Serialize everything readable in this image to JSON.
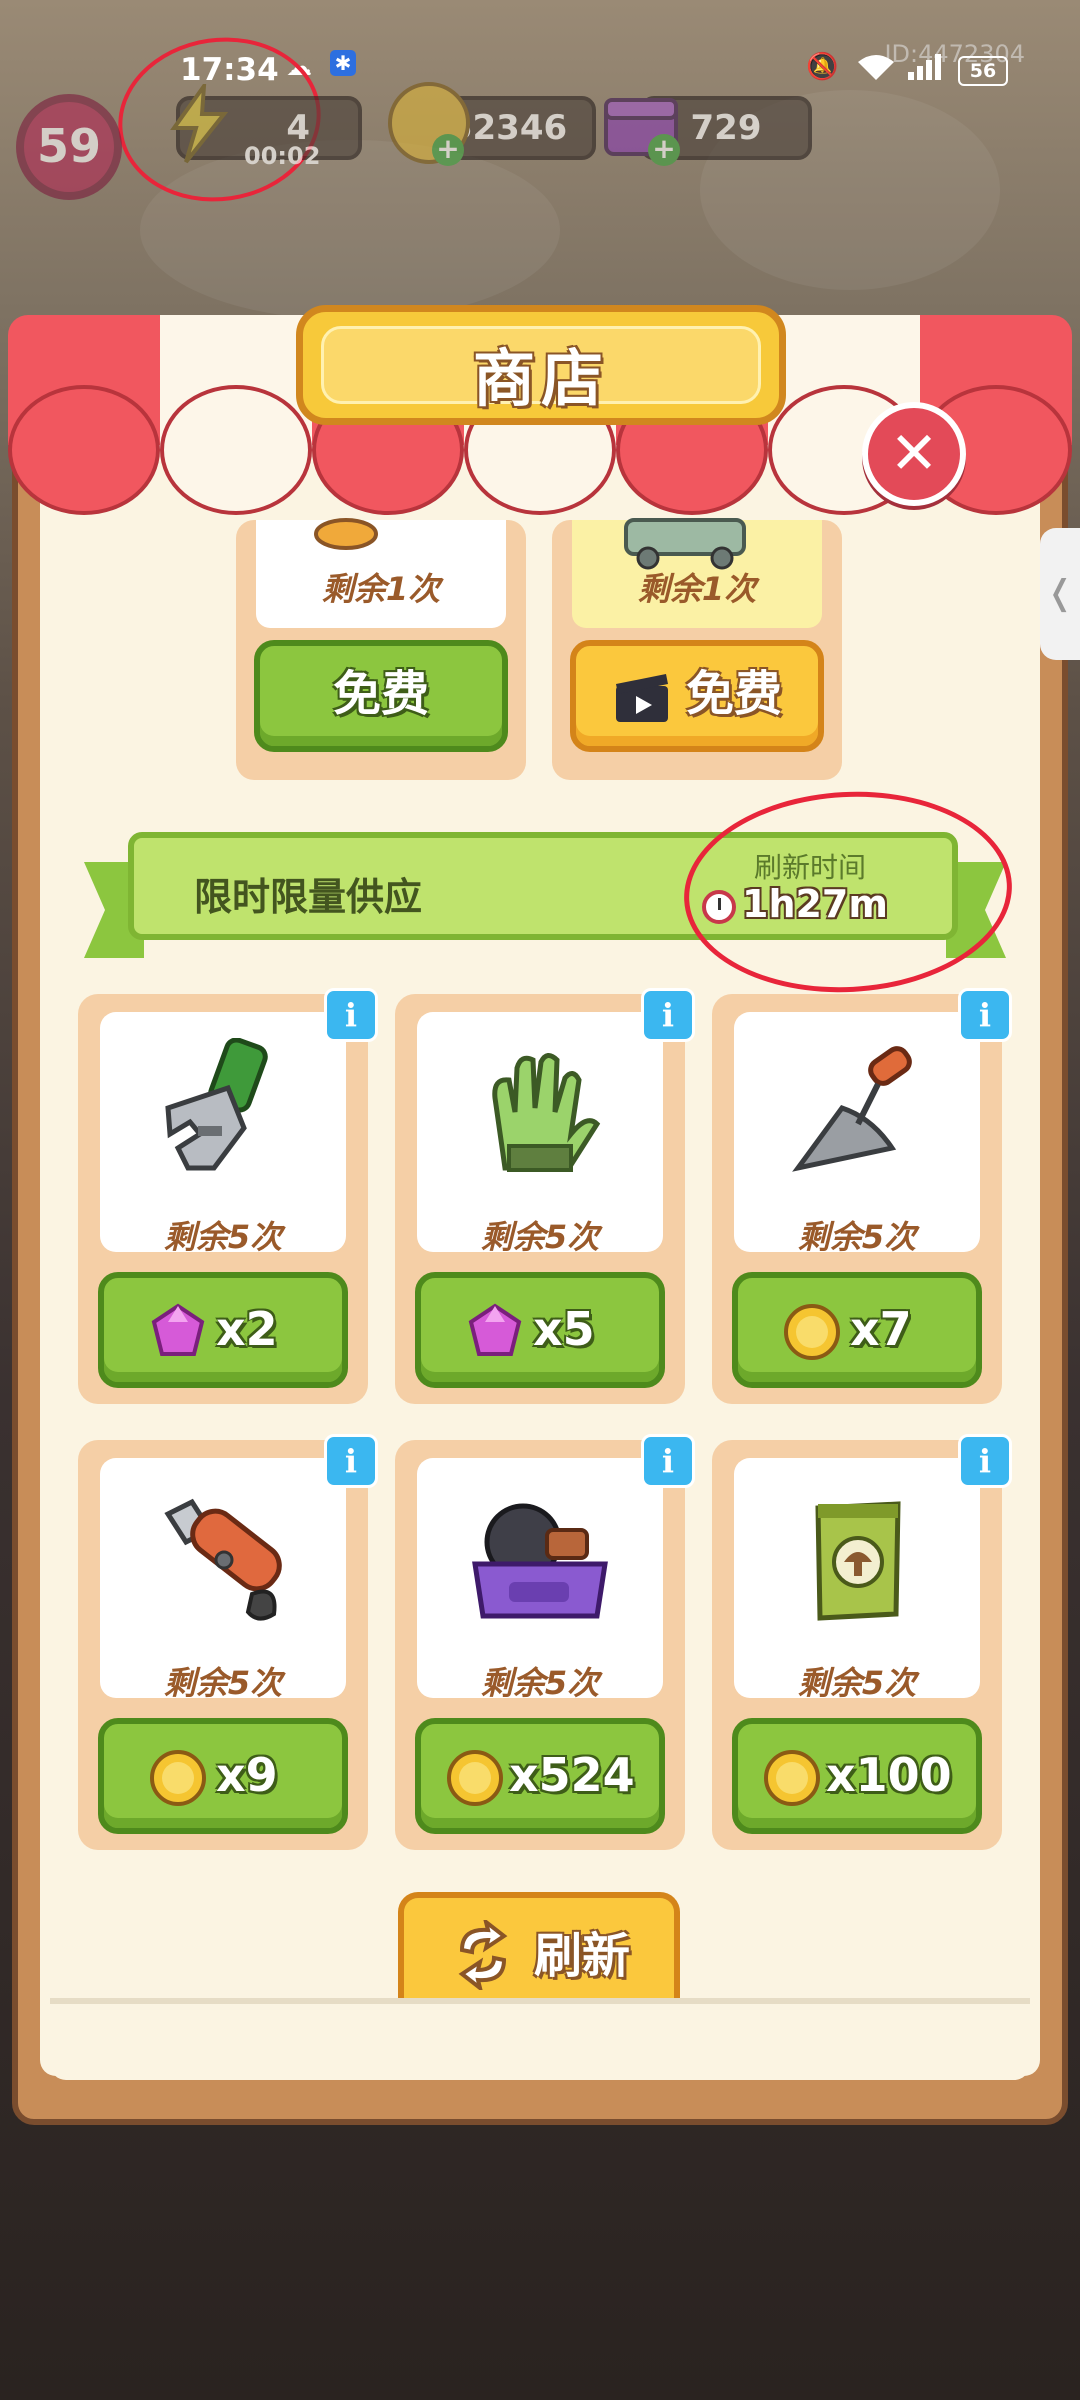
{
  "status_bar": {
    "time": "17:34",
    "device_id": "ID:4472304",
    "battery": "56",
    "icons": [
      "notification-icon",
      "app-icon",
      "mute-icon",
      "wifi-icon",
      "signal-icon",
      "battery-icon"
    ]
  },
  "hud": {
    "level": "59",
    "energy": "4",
    "energy_timer": "00:02",
    "coins": "52346",
    "gems": "729"
  },
  "shop": {
    "title": "商店",
    "close_glyph": "✕",
    "side_tab_glyph": "❬",
    "free_items": [
      {
        "remaining": "剩余1次",
        "button": "免费"
      },
      {
        "remaining": "剩余1次",
        "button": "免费"
      }
    ],
    "limited": {
      "title": "限时限量供应",
      "refresh_label": "刷新时间",
      "refresh_time": "1h27m"
    },
    "items": [
      {
        "name": "wrench",
        "remaining": "剩余5次",
        "currency": "gem",
        "price": "x2"
      },
      {
        "name": "glove",
        "remaining": "剩余5次",
        "currency": "gem",
        "price": "x5"
      },
      {
        "name": "trowel",
        "remaining": "剩余5次",
        "currency": "coin",
        "price": "x7"
      },
      {
        "name": "utility-knife",
        "remaining": "剩余5次",
        "currency": "coin",
        "price": "x9"
      },
      {
        "name": "tool-box",
        "remaining": "剩余5次",
        "currency": "coin",
        "price": "x524"
      },
      {
        "name": "seed-bag",
        "remaining": "剩余5次",
        "currency": "coin",
        "price": "x100"
      }
    ],
    "info_glyph": "i",
    "refresh_button": "刷新"
  },
  "colors": {
    "awning_red": "#f1575f",
    "awning_white": "#fdf6e9",
    "button_green": "#8cc63f",
    "button_orange": "#fbc83d",
    "annotation_red": "#e8253a"
  }
}
